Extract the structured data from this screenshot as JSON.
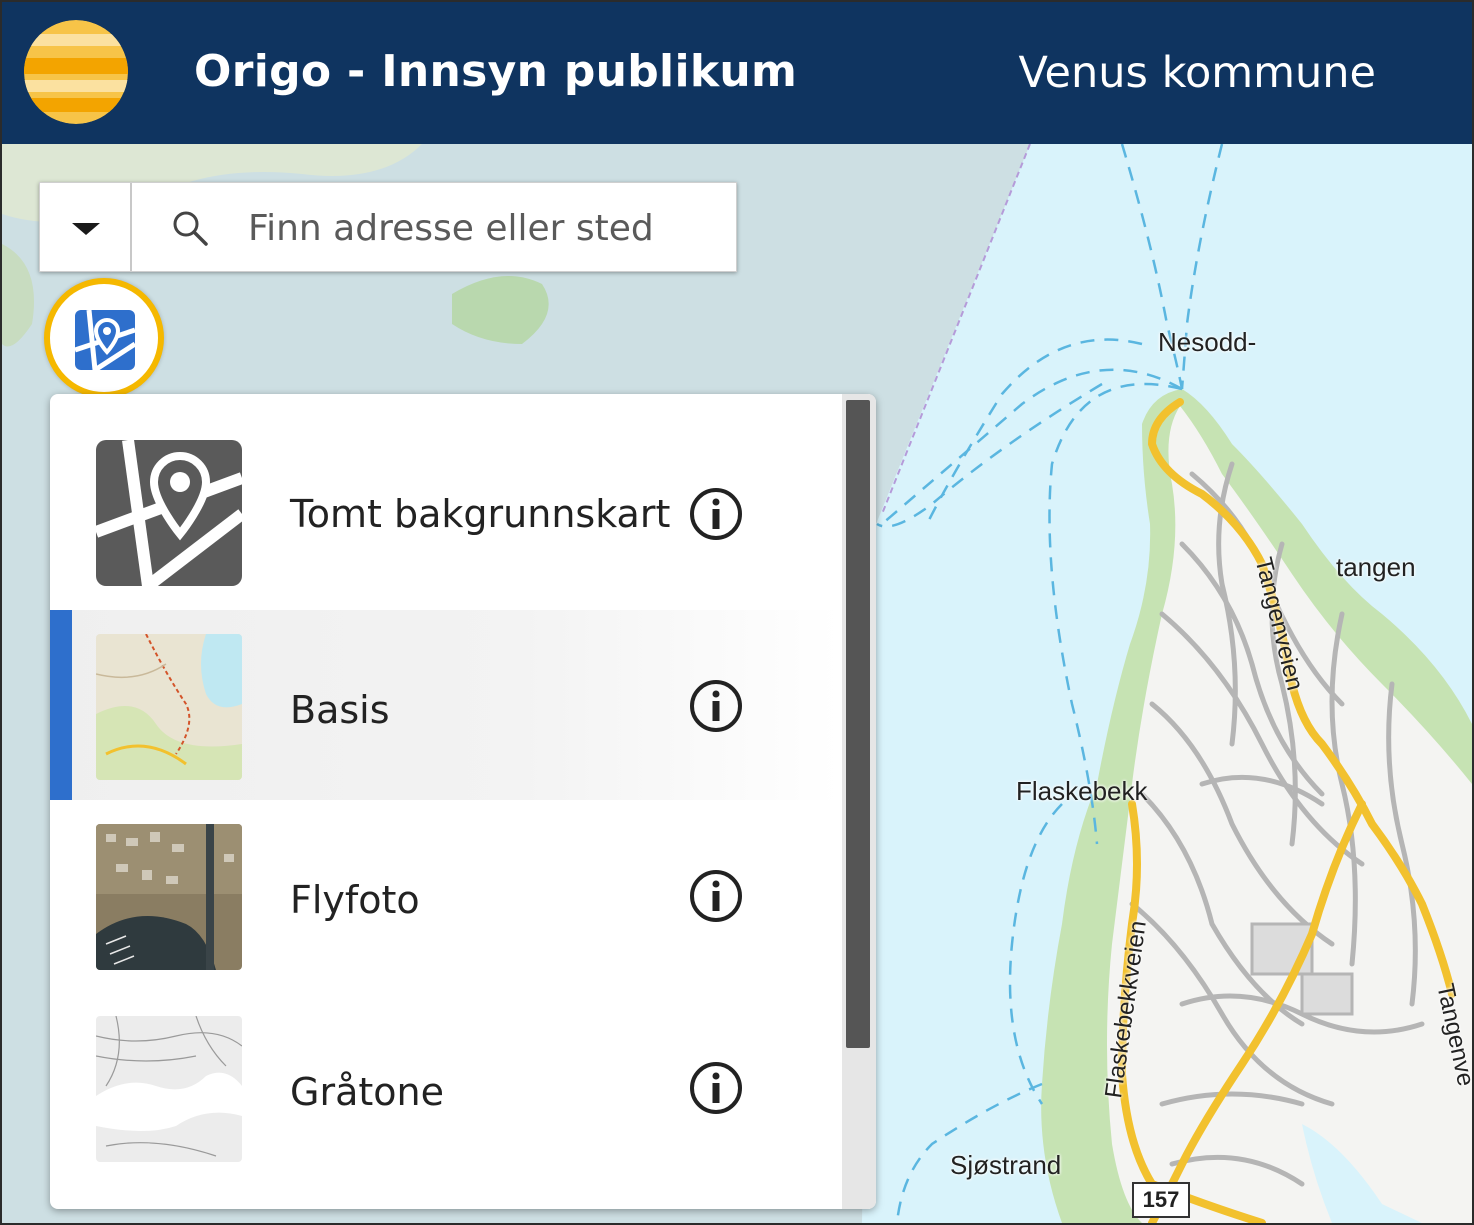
{
  "header": {
    "app_title": "Origo - Innsyn publikum",
    "municipality": "Venus kommune",
    "logo_icon": "sun-stripes-logo-icon",
    "background_color": "#0f3460"
  },
  "search": {
    "placeholder": "Finn adresse eller sted",
    "value": "",
    "toggle_icon": "caret-down-icon",
    "search_icon": "magnifier-icon"
  },
  "background_button": {
    "icon": "map-pin-icon",
    "highlight_color": "#f5b800"
  },
  "layers_panel": {
    "selected_index": 1,
    "accent_color": "#2e6fcc",
    "items": [
      {
        "label": "Tomt bakgrunnskart",
        "thumbnail": "empty-map-icon"
      },
      {
        "label": "Basis",
        "thumbnail": "topographic-thumbnail"
      },
      {
        "label": "Flyfoto",
        "thumbnail": "aerial-photo-thumbnail"
      },
      {
        "label": "Gråtone",
        "thumbnail": "greyscale-map-thumbnail"
      }
    ]
  },
  "map": {
    "place_labels": [
      "Nesodd-",
      "tangen",
      "Flaskebekk",
      "Sjøstrand"
    ],
    "road_labels": [
      "Tangenveien",
      "Flaskebekkveien",
      "Tangenve"
    ],
    "road_number": "157"
  }
}
